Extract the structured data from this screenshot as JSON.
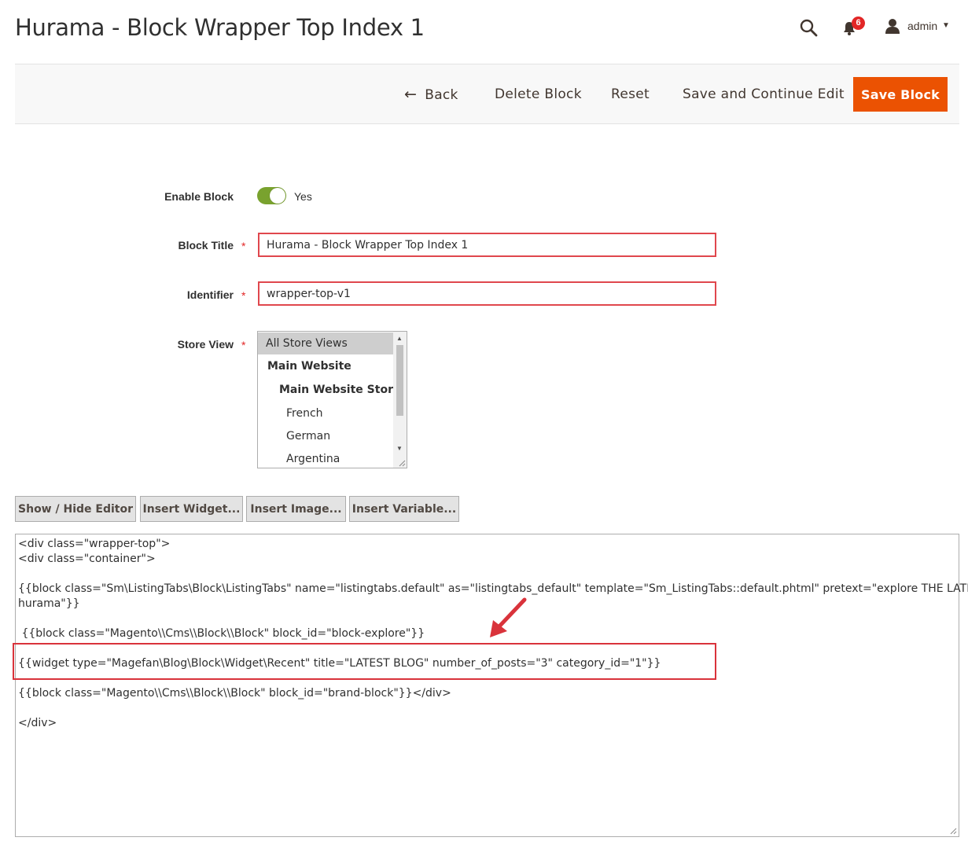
{
  "header": {
    "title": "Hurama - Block Wrapper Top Index 1",
    "notifications_count": "6",
    "user_name": "admin"
  },
  "actions": {
    "back": "Back",
    "delete": "Delete Block",
    "reset": "Reset",
    "save_continue": "Save and Continue Edit",
    "save": "Save Block"
  },
  "form": {
    "enable_label": "Enable Block",
    "enable_value": "Yes",
    "title_label": "Block Title",
    "title_value": "Hurama - Block Wrapper Top Index 1",
    "identifier_label": "Identifier",
    "identifier_value": "wrapper-top-v1",
    "store_label": "Store View",
    "store_options": [
      "All Store Views",
      "Main Website",
      "Main Website Store",
      "French",
      "German",
      "Argentina"
    ],
    "store_selected": "All Store Views"
  },
  "editor_buttons": {
    "show_hide": "Show / Hide Editor",
    "insert_widget": "Insert Widget...",
    "insert_image": "Insert Image...",
    "insert_variable": "Insert Variable..."
  },
  "editor": {
    "lines": [
      "<div class=\"wrapper-top\">",
      "<div class=\"container\">",
      "{{block class=\"Sm\\ListingTabs\\Block\\ListingTabs\" name=\"listingtabs.default\" as=\"listingtabs_default\" template=\"Sm_ListingTabs::default.phtml\" pretext=\"explore THE LATEST BY",
      "hurama\"}}",
      " {{block class=\"Magento\\\\Cms\\\\Block\\\\Block\" block_id=\"block-explore\"}}",
      "{{widget type=\"Magefan\\Blog\\Block\\Widget\\Recent\" title=\"LATEST BLOG\" number_of_posts=\"3\" category_id=\"1\"}}",
      "{{block class=\"Magento\\\\Cms\\\\Block\\\\Block\" block_id=\"brand-block\"}}</div>",
      "</div>"
    ]
  },
  "colors": {
    "accent": "#eb5202",
    "toggle_on": "#79a22e",
    "annotation_red": "#d9333b",
    "badge": "#e22626"
  }
}
